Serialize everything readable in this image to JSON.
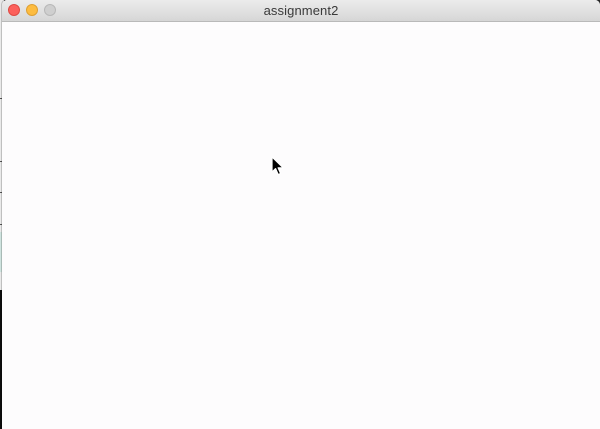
{
  "window": {
    "title": "assignment2"
  },
  "colors": {
    "close": "#fc605b",
    "minimize": "#fdbc40",
    "zoom_disabled": "#cfcfcf",
    "canvas_background": "#fdfcfd"
  },
  "icons": {
    "cursor": "arrow-pointer-icon"
  }
}
